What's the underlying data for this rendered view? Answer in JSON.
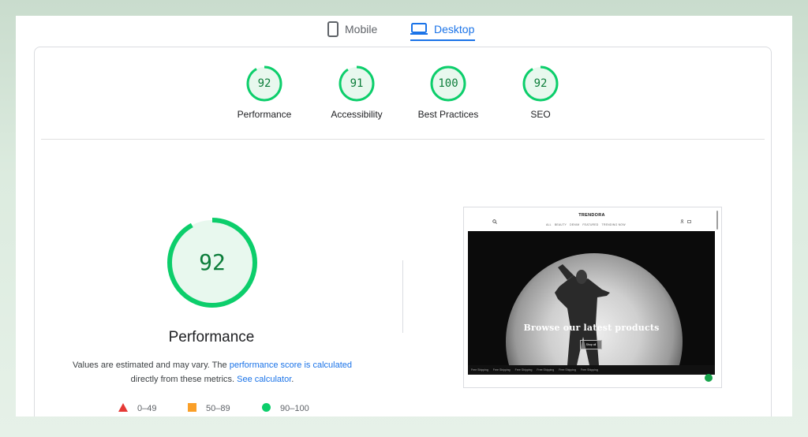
{
  "tabs": [
    {
      "label": "Mobile",
      "icon": "phone-icon",
      "active": false
    },
    {
      "label": "Desktop",
      "icon": "laptop-icon",
      "active": true
    }
  ],
  "colors": {
    "pass": "#0cce6b",
    "pass_text": "#0c7d3a",
    "accent": "#1a73e8",
    "fail": "#e53935",
    "average": "#fa9f28"
  },
  "categories": [
    {
      "score": "92",
      "label": "Performance"
    },
    {
      "score": "91",
      "label": "Accessibility"
    },
    {
      "score": "100",
      "label": "Best Practices"
    },
    {
      "score": "92",
      "label": "SEO"
    }
  ],
  "performance": {
    "score": "92",
    "title": "Performance",
    "desc_prefix": "Values are estimated and may vary. The ",
    "desc_link1": "performance score is calculated",
    "desc_middle": "directly from these metrics. ",
    "desc_link2": "See calculator",
    "desc_suffix": "."
  },
  "legend": [
    {
      "range": "0–49",
      "icon": "red-triangle-icon"
    },
    {
      "range": "50–89",
      "icon": "orange-square-icon"
    },
    {
      "range": "90–100",
      "icon": "green-circle-icon"
    }
  ],
  "screenshot": {
    "brand": "TRENDORA",
    "nav": [
      "ALL",
      "BEAUTY",
      "DENIM",
      "FEATURED",
      "TRENDING NOW"
    ],
    "headline": "Browse our latest products",
    "button": "Shop all",
    "strip": [
      "Free Shipping",
      "Free Shipping",
      "Free Shipping",
      "Free Shipping",
      "Free Shipping",
      "Free Shipping"
    ]
  }
}
